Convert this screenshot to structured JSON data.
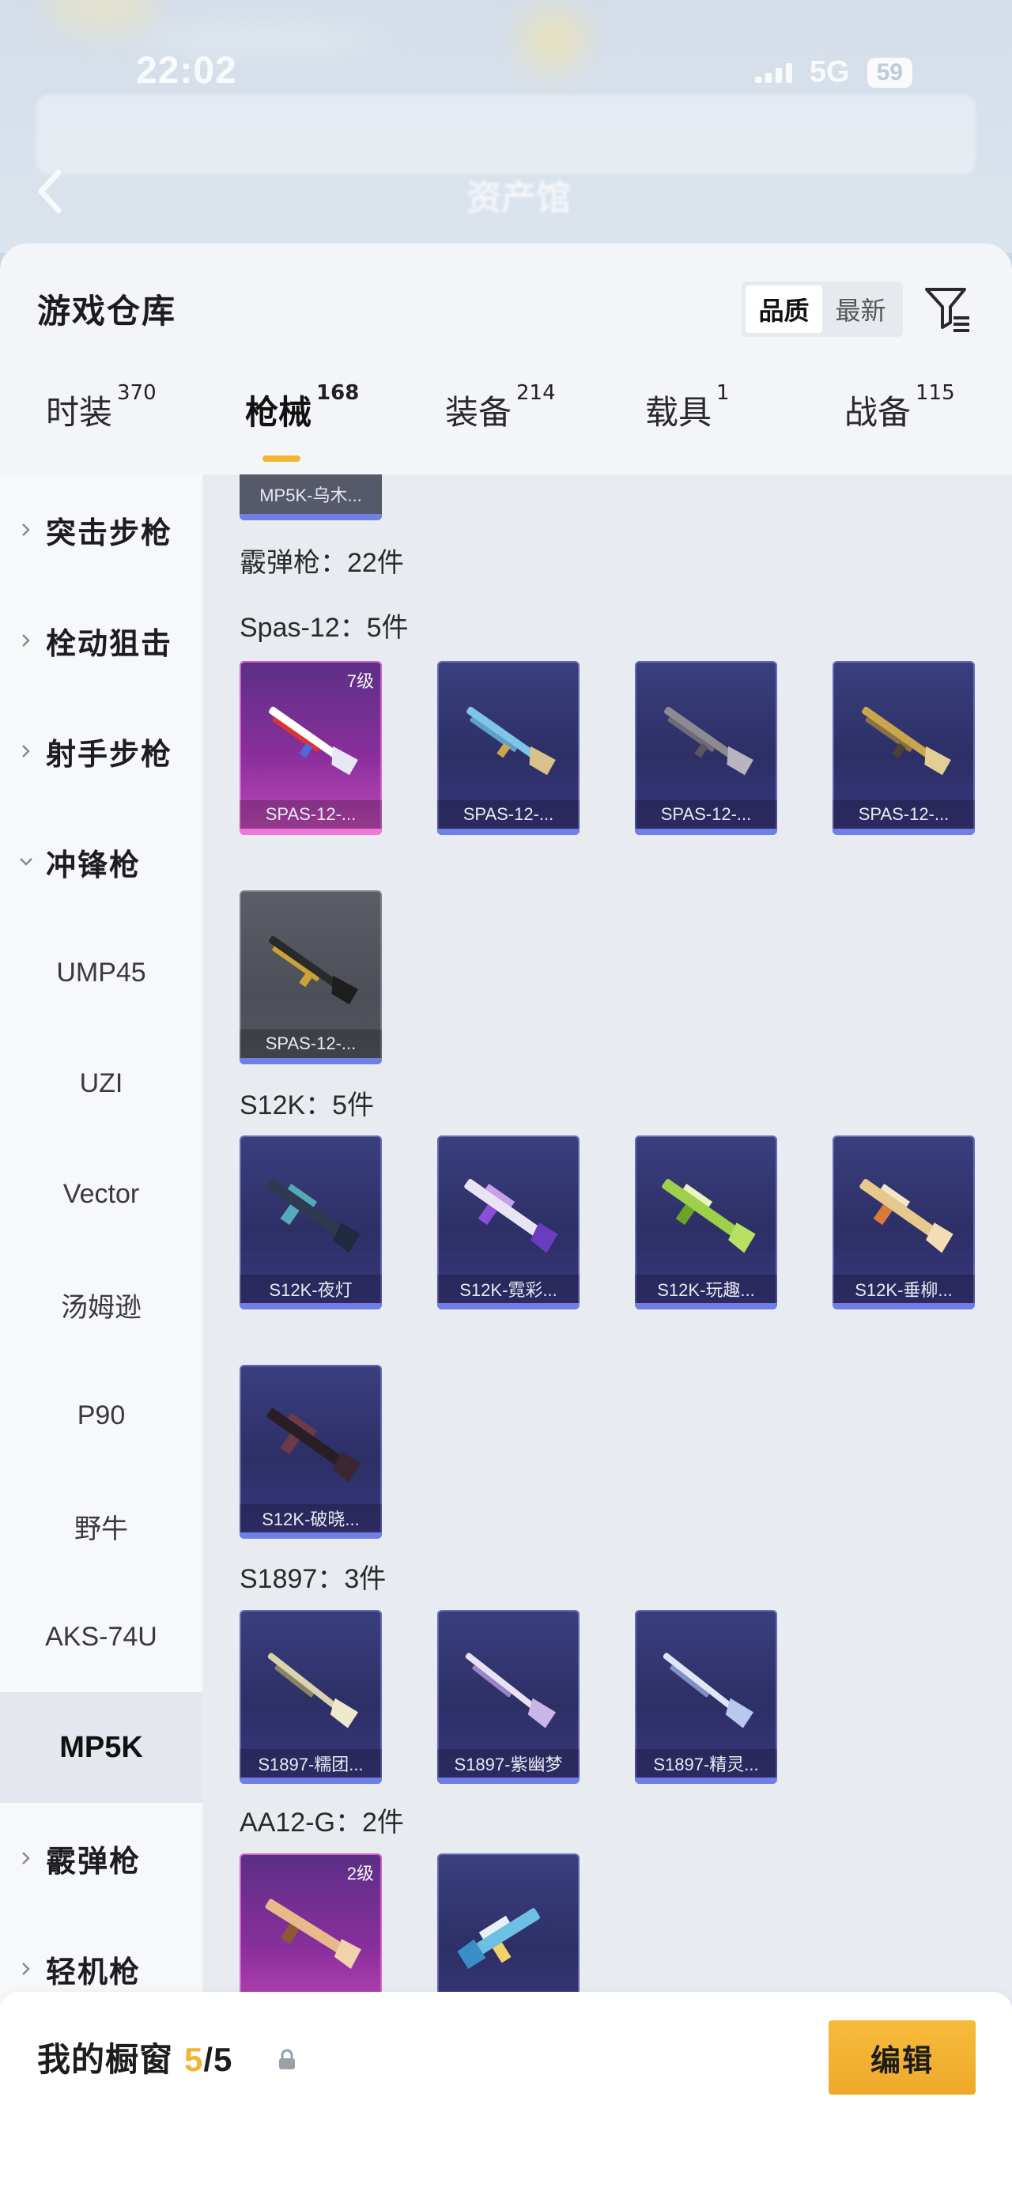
{
  "status_bar": {
    "time": "22:02",
    "network": "5G",
    "battery": "59"
  },
  "background_title": "资产馆",
  "header": {
    "title": "游戏仓库",
    "sort_options": [
      "品质",
      "最新"
    ],
    "active_sort": "品质"
  },
  "tabs": [
    {
      "label": "时装",
      "count": "370",
      "active": false
    },
    {
      "label": "枪械",
      "count": "168",
      "active": true
    },
    {
      "label": "装备",
      "count": "214",
      "active": false
    },
    {
      "label": "载具",
      "count": "1",
      "active": false
    },
    {
      "label": "战备",
      "count": "115",
      "active": false
    }
  ],
  "sidebar": {
    "categories": [
      {
        "label": "突击步枪",
        "expanded": false
      },
      {
        "label": "栓动狙击",
        "expanded": false
      },
      {
        "label": "射手步枪",
        "expanded": false
      },
      {
        "label": "冲锋枪",
        "expanded": true
      },
      {
        "label": "霰弹枪",
        "expanded": false
      },
      {
        "label": "轻机枪",
        "expanded": false
      }
    ],
    "smg_items": [
      "UMP45",
      "UZI",
      "Vector",
      "汤姆逊",
      "P90",
      "野牛",
      "AKS-74U",
      "MP5K"
    ],
    "selected": "MP5K"
  },
  "content": {
    "partial_card_label": "MP5K-乌木...",
    "section_title": "霰弹枪：22件",
    "groups": [
      {
        "title": "Spas-12：5件",
        "items": [
          {
            "label": "SPAS-12-...",
            "rarity": "pink",
            "level": "7级",
            "accent": "#ffffff"
          },
          {
            "label": "SPAS-12-...",
            "rarity": "purple",
            "accent": "#7fc4ea"
          },
          {
            "label": "SPAS-12-...",
            "rarity": "purple",
            "accent": "#8e8a94"
          },
          {
            "label": "SPAS-12-...",
            "rarity": "purple",
            "accent": "#c9a64e"
          },
          {
            "label": "SPAS-12-...",
            "rarity": "gray",
            "accent": "#c9a238"
          }
        ]
      },
      {
        "title": "S12K：5件",
        "items": [
          {
            "label": "S12K-夜灯",
            "rarity": "purple",
            "accent": "#55a9b8"
          },
          {
            "label": "S12K-霓彩...",
            "rarity": "purple",
            "accent": "#c7a0ea"
          },
          {
            "label": "S12K-玩趣...",
            "rarity": "purple",
            "accent": "#9fd04a"
          },
          {
            "label": "S12K-垂柳...",
            "rarity": "purple",
            "accent": "#e8c98d"
          },
          {
            "label": "S12K-破晓...",
            "rarity": "purple",
            "accent": "#6f3a48"
          }
        ]
      },
      {
        "title": "S1897：3件",
        "items": [
          {
            "label": "S1897-糯团...",
            "rarity": "purple",
            "accent": "#d9d3b0"
          },
          {
            "label": "S1897-紫幽梦",
            "rarity": "purple",
            "accent": "#c9b6e8"
          },
          {
            "label": "S1897-精灵...",
            "rarity": "purple",
            "accent": "#b9c7ee"
          }
        ]
      },
      {
        "title": "AA12-G：2件",
        "items": [
          {
            "label": "",
            "rarity": "pink",
            "level": "2级",
            "accent": "#e8b98a"
          },
          {
            "label": "",
            "rarity": "purple",
            "accent": "#6cc0e6"
          }
        ]
      }
    ]
  },
  "bottom_bar": {
    "label": "我的橱窗",
    "used": "5",
    "total": "/5",
    "edit_label": "编辑"
  },
  "colors": {
    "accent": "#f3b431",
    "card_purple": "#2d2f66",
    "card_pink": "#8a2f9c"
  }
}
